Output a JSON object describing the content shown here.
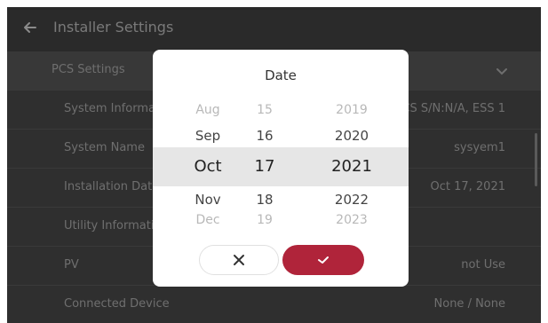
{
  "header": {
    "title": "Installer Settings"
  },
  "list": {
    "section": {
      "label": "PCS Settings"
    },
    "rows": [
      {
        "label": "System Information",
        "value": "PCS S/N:N/A, ESS 1"
      },
      {
        "label": "System Name",
        "value": "sysyem1"
      },
      {
        "label": "Installation Date",
        "value": "Oct 17, 2021"
      },
      {
        "label": "Utility Information",
        "value": ""
      },
      {
        "label": "PV",
        "value": "not Use"
      },
      {
        "label": "Connected Device",
        "value": "None / None"
      }
    ]
  },
  "dialog": {
    "title": "Date",
    "months": [
      "Aug",
      "Sep",
      "Oct",
      "Nov",
      "Dec"
    ],
    "days": [
      "15",
      "16",
      "17",
      "18",
      "19"
    ],
    "years": [
      "2019",
      "2020",
      "2021",
      "2022",
      "2023"
    ],
    "selected": {
      "month": "Oct",
      "day": "17",
      "year": "2021"
    }
  },
  "colors": {
    "accent": "#b0243a",
    "background": "#2b2b2b",
    "selection_band": "#e6e6e6"
  },
  "icons": {
    "back": "arrow-left-icon",
    "chevron": "chevron-down-icon",
    "cancel": "close-icon",
    "confirm": "check-icon"
  }
}
